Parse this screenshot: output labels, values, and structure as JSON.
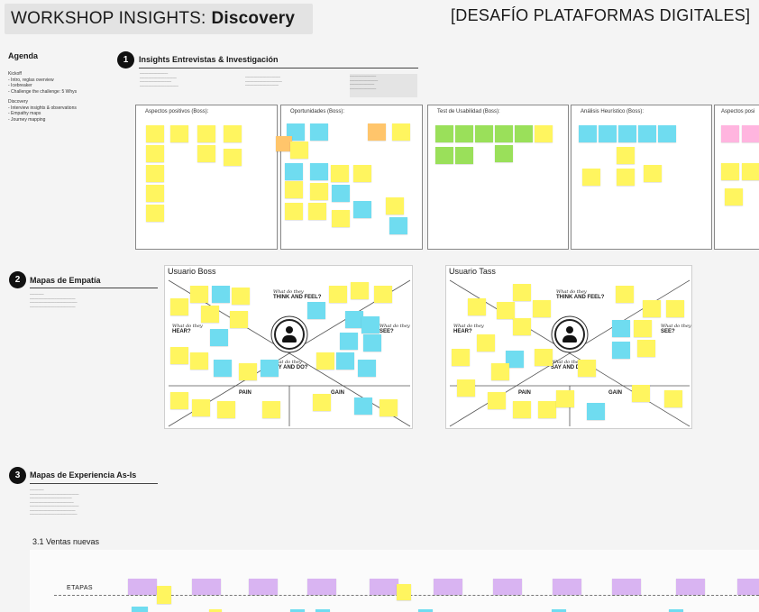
{
  "header": {
    "title_prefix": "WORKSHOP INSIGHTS:",
    "title_strong": "Discovery",
    "challenge": "[DESAFÍO PLATAFORMAS DIGITALES]"
  },
  "agenda": {
    "title": "Agenda",
    "kickoff_label": "Kickoff",
    "kickoff_items": [
      "- Intro, reglas overview",
      "- Icebreaker",
      "- Challenge the challenge: 5 Whys"
    ],
    "discovery_label": "Discovery",
    "discovery_items": [
      "- Interview insights & observations",
      "- Empathy maps",
      "- Journey mapping"
    ]
  },
  "sections": {
    "s1": {
      "num": "1",
      "title": "Insights Entrevistas & Investigación"
    },
    "s2": {
      "num": "2",
      "title": "Mapas de Empatía"
    },
    "s3": {
      "num": "3",
      "title": "Mapas de Experiencia As-Is"
    }
  },
  "panels": [
    {
      "label": "Aspectos positivos (Boss):"
    },
    {
      "label": "Oportunidades (Boss):"
    },
    {
      "label": "Test de Usabilidad (Boss):"
    },
    {
      "label": "Análisis Heurístico (Boss):"
    },
    {
      "label": "Aspectos posi"
    }
  ],
  "empathy_maps": [
    {
      "label": "Usuario Boss"
    },
    {
      "label": "Usuario Tass"
    }
  ],
  "empathy_words": {
    "think": "THINK AND FEEL?",
    "hear": "HEAR?",
    "see": "SEE?",
    "say": "SAY AND DO?",
    "pain": "PAIN",
    "gain": "GAIN",
    "what": "What do they"
  },
  "journey": {
    "label": "3.1 Ventas nuevas",
    "stages_label": "ETAPAS"
  },
  "colors": {
    "yellow": "#fff55f",
    "orange": "#ffc56b",
    "green": "#9ae05a",
    "cyan": "#6fdcf0",
    "pink": "#ffb5df",
    "violet": "#d9b4f2"
  }
}
